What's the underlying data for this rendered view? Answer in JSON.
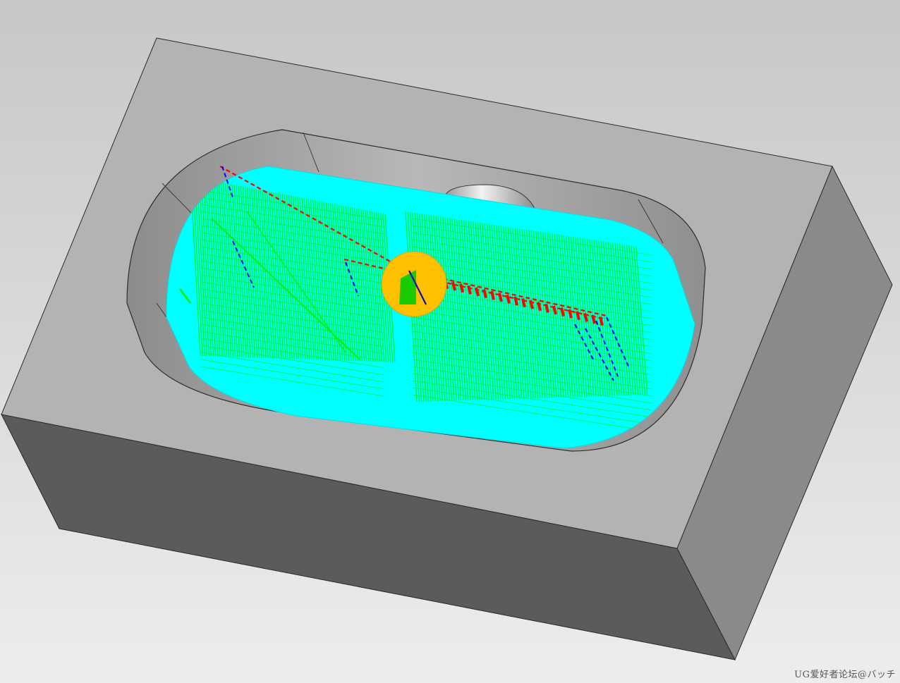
{
  "viewport": {
    "watermark": "UG爱好者论坛@バッチ"
  },
  "colors": {
    "background_top": "#c9cacc",
    "background_bottom": "#ececec",
    "block_top": "#b2b2b2",
    "block_front": "#5b5b5b",
    "block_side": "#8a8a8a",
    "pocket_wall": "#9a9a9a",
    "pocket_floor_region": "#00ffff",
    "toolpath_cut": "#00ee00",
    "toolpath_rapid": "#ff0000",
    "toolpath_engage": "#0000ff",
    "tool": "#ffc000"
  },
  "icons": {
    "tool": "cutter-tool-icon"
  }
}
